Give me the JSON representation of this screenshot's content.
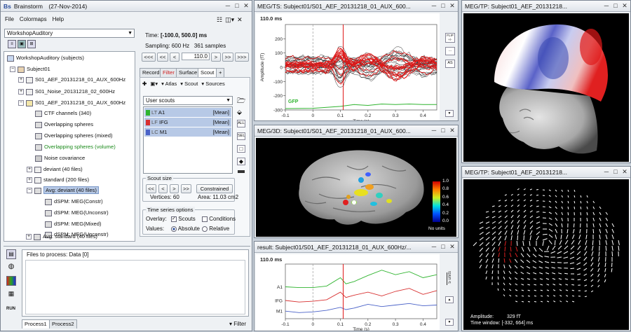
{
  "brainstorm": {
    "title": "Brainstorm",
    "date": "(27-Nov-2014)",
    "menus": [
      "File",
      "Colormaps",
      "Help"
    ],
    "protocol": "WorkshopAuditory",
    "tree": {
      "root": "WorkshopAuditory (subjects)",
      "subject": "Subject01",
      "raw1": "S01_AEF_20131218_01_AUX_600Hz",
      "raw2": "S01_Noise_20131218_02_600Hz",
      "cond": "S01_AEF_20131218_01_AUX_600Hz",
      "ctf": "CTF channels (340)",
      "os1": "Overlapping spheres",
      "os2": "Overlapping spheres (mixed)",
      "os3": "Overlapping spheres (volume)",
      "noise": "Noise covariance",
      "deviant": "deviant (40 files)",
      "standard": "standard (200 files)",
      "avg_dev": "Avg: deviant (40 files)",
      "dspm1": "dSPM: MEG(Constr)",
      "dspm2": "dSPM: MEG(Unconstr)",
      "dspm3": "dSPM: MEG(Mixed)",
      "dspm4": "dSPM: MEG(Unconstr)",
      "avg_std": "Avg: standard (40 files)"
    },
    "time_label": "Time:",
    "time_range": "[-100.0, 500.0] ms",
    "sampling": "Sampling: 600 Hz",
    "samples": "361 samples",
    "time_value": "110.0",
    "time_unit": "ms",
    "nav_left": [
      "<<<",
      "<<",
      "<"
    ],
    "nav_right": [
      ">",
      ">>",
      ">>>"
    ],
    "tabs": [
      "Record",
      "Filter",
      "Surface",
      "Scout",
      "+"
    ],
    "toolbar": {
      "atlas": "Atlas",
      "scout": "Scout",
      "sources": "Sources"
    },
    "scout_list_label": "User scouts",
    "scouts": [
      {
        "tag": "LT",
        "name": "A1",
        "fn": "[Mean]",
        "color": "#2fb42f"
      },
      {
        "tag": "LF",
        "name": "IFG",
        "fn": "[Mean]",
        "color": "#d83030"
      },
      {
        "tag": "LC",
        "name": "M1",
        "fn": "[Mean]",
        "color": "#4a62c8"
      }
    ],
    "side_btns": [
      "ALL",
      "SEL"
    ],
    "scout_size_label": "Scout size",
    "size_btns": [
      "<<",
      "<",
      ">",
      ">>"
    ],
    "constrained": "Constrained",
    "vertices": "Vertices: 60",
    "area": "Area: 11.03 cm2",
    "ts_label": "Time series options",
    "overlay_label": "Overlay:",
    "opt_scouts": "Scouts",
    "opt_conditions": "Conditions",
    "values_label": "Values:",
    "opt_absolute": "Absolute",
    "opt_relative": "Relative",
    "process_label": "Files to process: Data [0]",
    "run_label": "RUN",
    "proc_tabs": [
      "Process1",
      "Process2"
    ],
    "filter_label": "Filter"
  },
  "ts_window": {
    "title": "MEG/TS: Subject01/S01_AEF_20131218_01_AUX_600...",
    "time_readout": "110.0 ms",
    "ylabel": "Amplitude (fT)",
    "xlabel": "Time (s)",
    "gfp_label": "GFP",
    "side_btns": [
      "FLIP +/-",
      "...",
      "AS"
    ]
  },
  "tp_top_title": "MEG/TP: Subject01_AEF_20131218...",
  "d3_title": "MEG/3D: Subject01/S01_AEF_20131218_01_AUX_600...",
  "colorbar_ticks": [
    "1.0",
    "0.8",
    "0.6",
    "0.4",
    "0.2",
    "0.0"
  ],
  "colorbar_unit": "No units",
  "tp_bottom": {
    "title": "MEG/TP: Subject01_AEF_20131218...",
    "amp_label": "Amplitude:",
    "amp_value": "329 fT",
    "tw_label": "Time window:",
    "tw_value": "[-332, 664] ms"
  },
  "result_window": {
    "title": "result: Subject01/S01_AEF_20131218_01_AUX_600Hz/...",
    "time_readout": "110.0 ms",
    "scale_label": "5 units",
    "xlabel": "Time (s)",
    "rows": [
      "A1",
      "IFG",
      "M1"
    ]
  },
  "chart_data": [
    {
      "type": "line",
      "ylabel": "Amplitude (fT)",
      "xlabel": "Time (s)",
      "xlim": [
        -0.1,
        0.45
      ],
      "ylim": [
        -300,
        300
      ],
      "x_ticks": [
        "-0.1",
        "0",
        "0.1",
        "0.2",
        "0.3",
        "0.4"
      ],
      "y_ticks": [
        "200",
        "100",
        "0",
        "-100",
        "-200",
        "-300"
      ],
      "cursor_x": 0.11,
      "zero_line_x": 0,
      "series": [
        {
          "name": "GFP",
          "color": "#2fb42f",
          "x": [
            -0.1,
            0,
            0.05,
            0.1,
            0.15,
            0.2,
            0.25,
            0.3,
            0.35,
            0.4,
            0.45
          ],
          "y": [
            -290,
            -288,
            -282,
            -275,
            -262,
            -268,
            -258,
            -262,
            -258,
            -262,
            -262
          ]
        }
      ]
    },
    {
      "type": "line",
      "xlabel": "Time (s)",
      "xlim": [
        -0.1,
        0.45
      ],
      "x_ticks": [
        "-0.1",
        "0",
        "0.1",
        "0.2",
        "0.3",
        "0.4"
      ],
      "cursor_x": 0.11,
      "zero_line_x": 0,
      "series": [
        {
          "name": "A1",
          "color": "#2fb42f",
          "x": [
            -0.1,
            -0.05,
            0,
            0.05,
            0.1,
            0.12,
            0.15,
            0.2,
            0.25,
            0.3,
            0.35,
            0.4,
            0.45
          ],
          "y": [
            2.0,
            1.9,
            1.9,
            2.1,
            3.2,
            2.4,
            2.7,
            3.5,
            4.2,
            3.6,
            4.0,
            3.2,
            3.6
          ]
        },
        {
          "name": "IFG",
          "color": "#d83030",
          "x": [
            -0.1,
            -0.05,
            0,
            0.05,
            0.1,
            0.12,
            0.15,
            0.2,
            0.25,
            0.3,
            0.35,
            0.4,
            0.45
          ],
          "y": [
            0.2,
            0.0,
            0.1,
            0.3,
            1.3,
            0.6,
            0.9,
            1.3,
            0.8,
            1.4,
            1.8,
            1.0,
            1.5
          ]
        },
        {
          "name": "M1",
          "color": "#4a62c8",
          "x": [
            -0.1,
            -0.05,
            0,
            0.05,
            0.1,
            0.12,
            0.15,
            0.2,
            0.25,
            0.3,
            0.35,
            0.4,
            0.45
          ],
          "y": [
            -1.2,
            -1.4,
            -1.3,
            -1.1,
            -0.7,
            -1.0,
            -0.8,
            -0.3,
            -0.6,
            -0.4,
            -0.2,
            -0.5,
            -0.4
          ]
        }
      ]
    }
  ]
}
